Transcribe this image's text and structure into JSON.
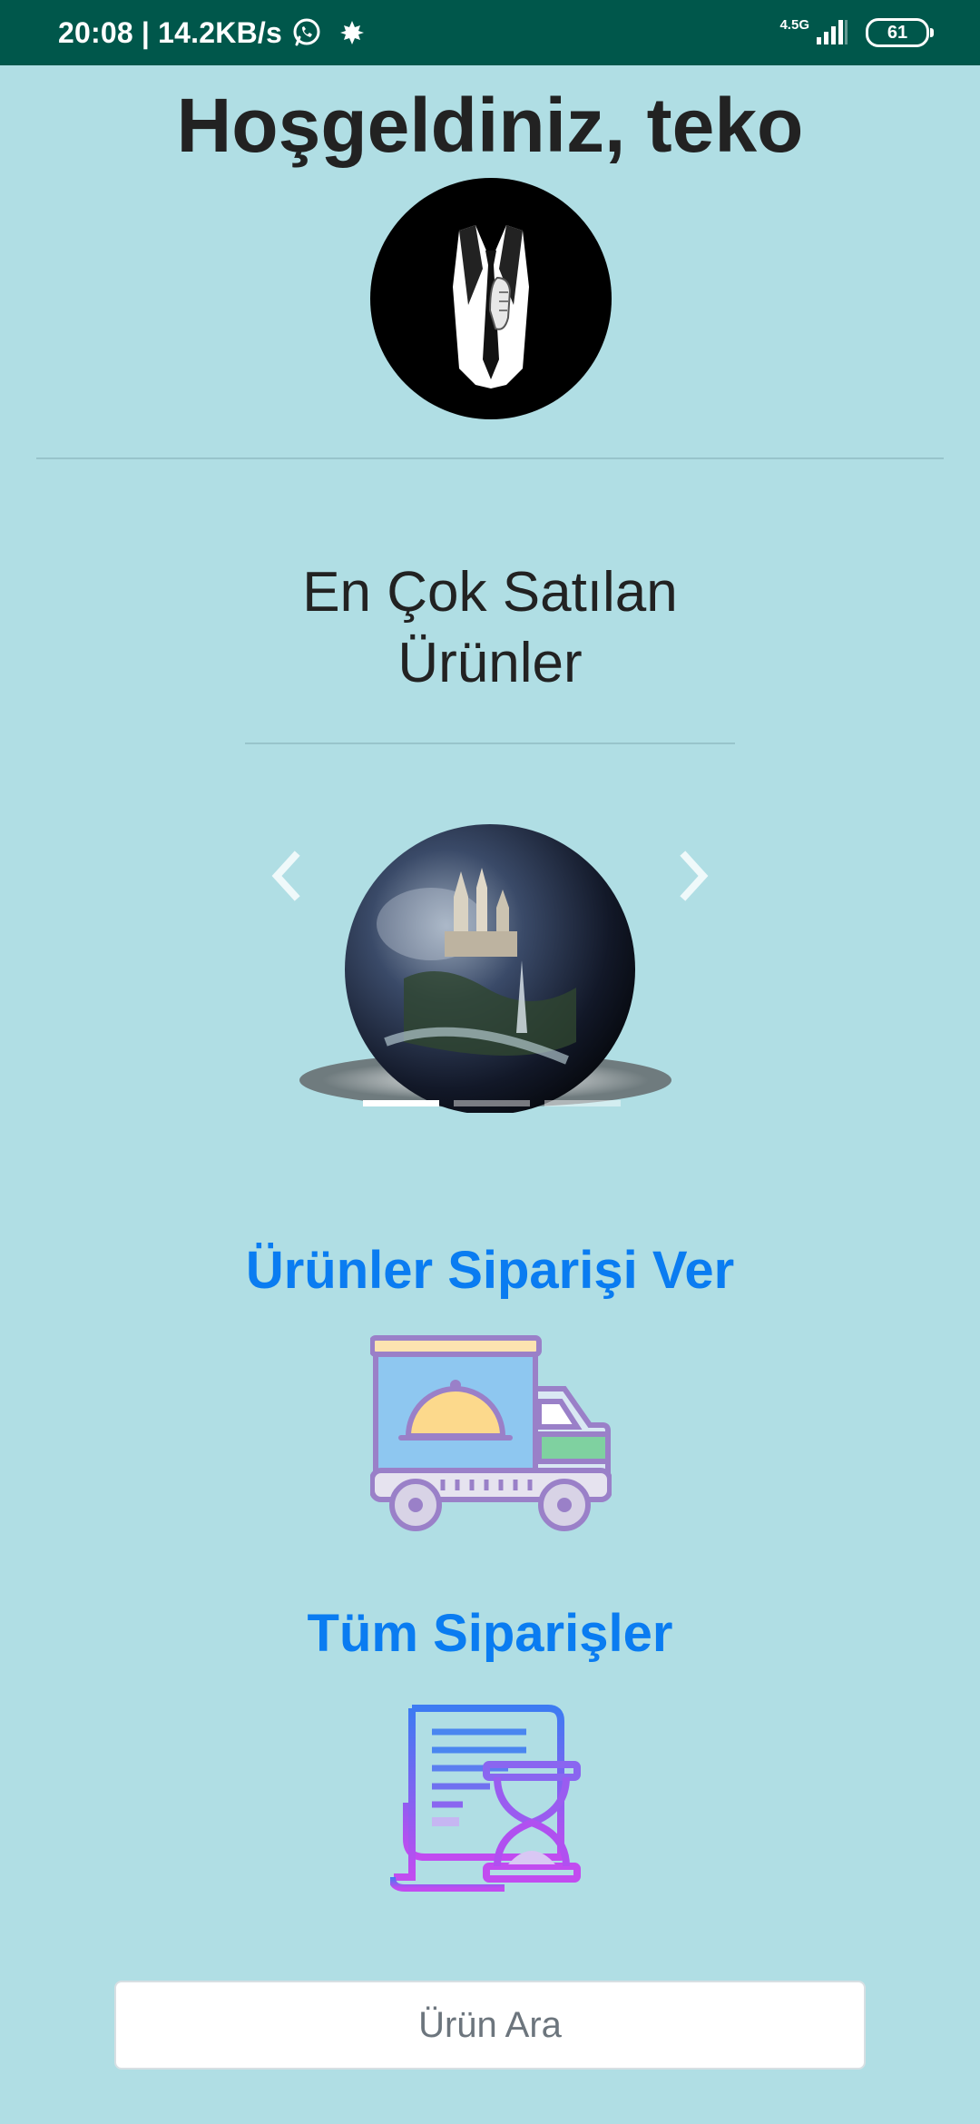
{
  "status_bar": {
    "time_speed": "20:08 | 14.2KB/s",
    "network_type": "4.5G",
    "battery": "61"
  },
  "welcome": {
    "text": "Hoşgeldiniz, teko"
  },
  "best_sellers": {
    "title": "En Çok Satılan Ürünler",
    "carousel": {
      "slide_count": 3,
      "active_index": 0
    }
  },
  "order_products": {
    "label": "Ürünler Siparişi Ver"
  },
  "all_orders": {
    "label": "Tüm Siparişler"
  },
  "search": {
    "placeholder": "Ürün Ara"
  },
  "colors": {
    "status_bar": "#00574b",
    "background": "#b0dee4",
    "link": "#0a7cf1"
  }
}
